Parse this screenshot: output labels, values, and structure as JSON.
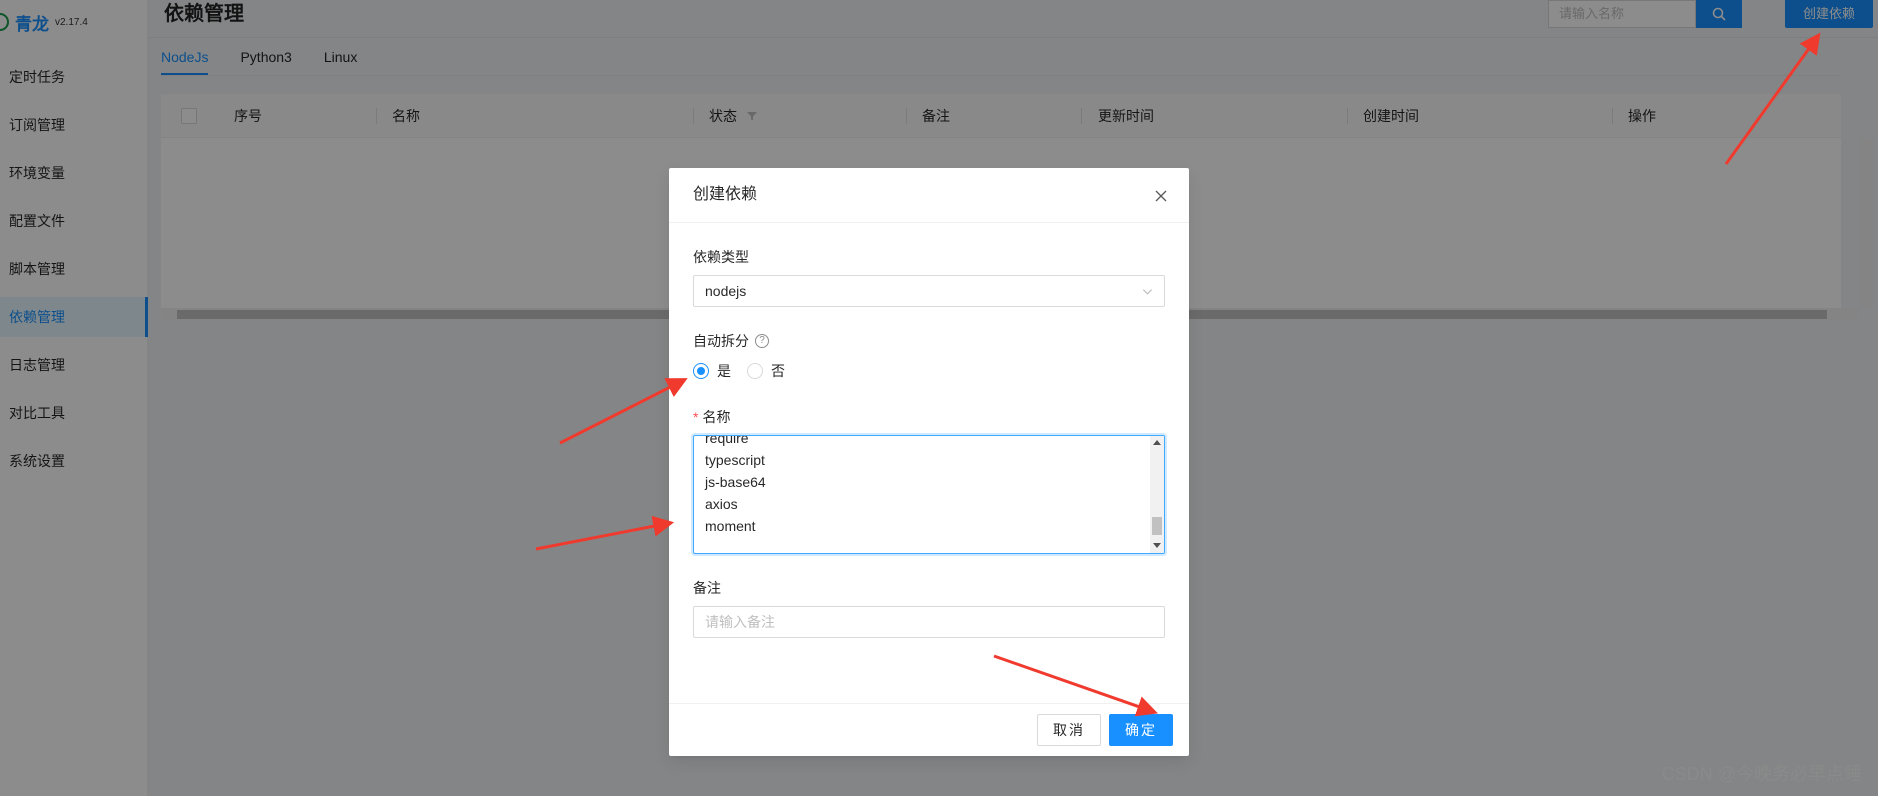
{
  "app": {
    "name": "青龙",
    "version": "v2.17.4"
  },
  "sidebar": {
    "items": [
      {
        "label": "定时任务",
        "active": false
      },
      {
        "label": "订阅管理",
        "active": false
      },
      {
        "label": "环境变量",
        "active": false
      },
      {
        "label": "配置文件",
        "active": false
      },
      {
        "label": "脚本管理",
        "active": false
      },
      {
        "label": "依赖管理",
        "active": true
      },
      {
        "label": "日志管理",
        "active": false
      },
      {
        "label": "对比工具",
        "active": false
      },
      {
        "label": "系统设置",
        "active": false
      }
    ]
  },
  "header": {
    "title": "依赖管理",
    "search_placeholder": "请输入名称",
    "create_label": "创建依赖"
  },
  "tabs": [
    "NodeJs",
    "Python3",
    "Linux"
  ],
  "table": {
    "columns": [
      "序号",
      "名称",
      "状态",
      "备注",
      "更新时间",
      "创建时间",
      "操作"
    ]
  },
  "modal": {
    "title": "创建依赖",
    "type_label": "依赖类型",
    "type_value": "nodejs",
    "split_label": "自动拆分",
    "split_options": [
      "是",
      "否"
    ],
    "split_selected": "是",
    "name_label": "名称",
    "name_lines": [
      "require",
      "typescript",
      "js-base64",
      "axios",
      "moment"
    ],
    "remark_label": "备注",
    "remark_placeholder": "请输入备注",
    "cancel_label": "取消",
    "ok_label": "确定"
  },
  "watermark": "CSDN @今晚务必早点睡",
  "colors": {
    "primary": "#1890ff",
    "arrow": "#f03a2e",
    "logo": "#1a9c4a"
  }
}
